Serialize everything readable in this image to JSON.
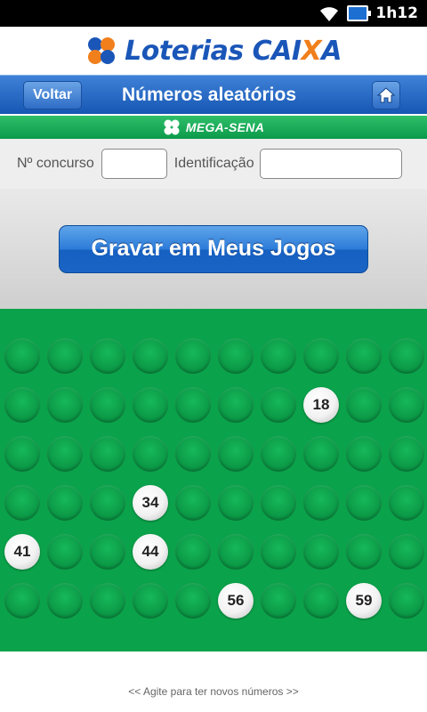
{
  "statusbar": {
    "time": "1h12"
  },
  "header": {
    "logo_word": "Loterias",
    "logo_caixa_a": "CAI",
    "logo_caixa_x": "X",
    "logo_caixa_b": "A"
  },
  "nav": {
    "back_label": "Voltar",
    "title": "Números aleatórios"
  },
  "game": {
    "name": "MEGA-SENA"
  },
  "form": {
    "concurso_label": "Nº concurso",
    "concurso_value": "",
    "ident_label": "Identificação",
    "ident_value": ""
  },
  "save_button": {
    "label": "Gravar em Meus Jogos"
  },
  "grid": {
    "rows": [
      [
        "",
        "",
        "",
        "",
        "",
        "",
        "",
        "",
        "",
        ""
      ],
      [
        "",
        "",
        "",
        "",
        "",
        "",
        "",
        "18",
        "",
        ""
      ],
      [
        "",
        "",
        "",
        "",
        "",
        "",
        "",
        "",
        "",
        ""
      ],
      [
        "",
        "",
        "",
        "34",
        "",
        "",
        "",
        "",
        "",
        ""
      ],
      [
        "41",
        "",
        "",
        "44",
        "",
        "",
        "",
        "",
        "",
        ""
      ],
      [
        "",
        "",
        "",
        "",
        "",
        "56",
        "",
        "",
        "59",
        ""
      ]
    ]
  },
  "footer": {
    "hint": "<< Agite para ter novos números >>"
  },
  "colors": {
    "brand_blue": "#1a56b8",
    "brand_orange": "#f07f1c",
    "mega_green": "#0aa24a"
  }
}
